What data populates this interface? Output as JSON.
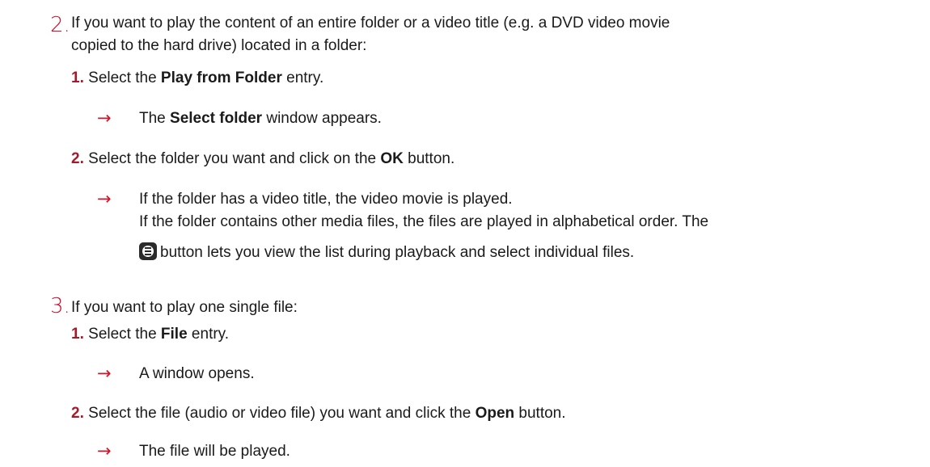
{
  "doc": {
    "step2": {
      "number": "2.",
      "line1": "If you want to play the content of an entire folder or a video title (e.g. a DVD video movie",
      "line2": "copied to the hard drive) located in a folder:",
      "sub1": {
        "num": "1.",
        "pre": "Select the ",
        "bold": "Play from Folder",
        "post": " entry."
      },
      "res1": {
        "arrow": "→",
        "pre": "The ",
        "bold": "Select folder",
        "post": " window appears."
      },
      "sub2": {
        "num": "2.",
        "pre": "Select the folder you want and click on the ",
        "bold": "OK",
        "post": " button."
      },
      "res2": {
        "arrow": "→",
        "line1": "If the folder has a video title, the video movie is played.",
        "line2": "If the folder contains other media files, the files are played in alphabetical order. The",
        "line3": "button lets you view the list during playback and select individual files."
      }
    },
    "step3": {
      "number": "3.",
      "line1": "If you want to play one single file:",
      "sub1": {
        "num": "1.",
        "pre": "Select the ",
        "bold": "File",
        "post": " entry."
      },
      "res1": {
        "arrow": "→",
        "text": "A window opens."
      },
      "sub2": {
        "num": "2.",
        "pre": "Select the file (audio or video file) you want and click the ",
        "bold": "Open",
        "post": " button."
      },
      "res2": {
        "arrow": "→",
        "text": "The file will be played."
      }
    }
  }
}
